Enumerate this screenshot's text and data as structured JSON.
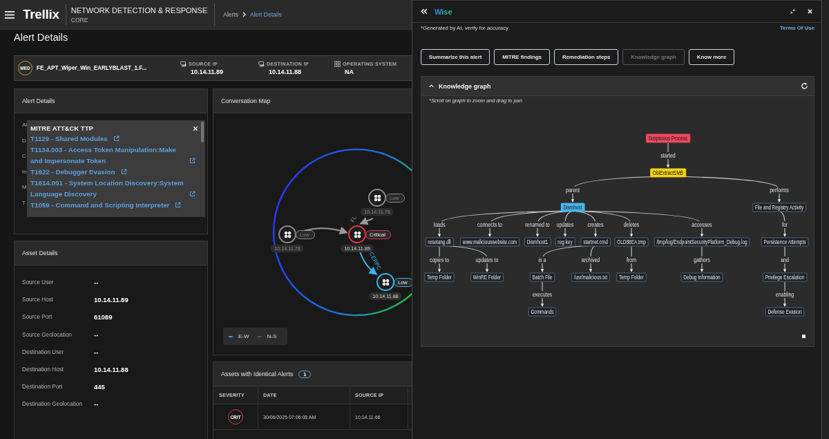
{
  "header": {
    "brand": "Trellix",
    "product": "NETWORK DETECTION & RESPONSE",
    "edition": "CORE",
    "breadcrumb": [
      {
        "label": "Alerts",
        "selected": false
      },
      {
        "label": "Alert Details",
        "selected": true
      }
    ]
  },
  "page_title": "Alert Details",
  "summary": {
    "severity": "MED",
    "name": "FE_APT_Wiper_Win_EARLYBLAST_1.F...",
    "fields": [
      {
        "label": "SOURCE IP",
        "value": "10.14.11.89",
        "kind": "monitor"
      },
      {
        "label": "DESTINATION IP",
        "value": "10.14.11.88",
        "kind": "monitor"
      },
      {
        "label": "OPERATING SYSTEM",
        "value": "NA",
        "kind": "grid"
      }
    ]
  },
  "alert_details": {
    "title": "Alert Details",
    "labels": [
      "Al",
      "D",
      "C",
      "In",
      "M",
      "T"
    ],
    "mitre_popup": {
      "title": "MITRE ATT&CK TTP",
      "links": [
        "T1129 - Shared Modules",
        "T1134.003 - Access Token Manipulation:Make and Impersonate Token",
        "T1622 - Debugger Evasion",
        "T1614.001 - System Location Discovery:System Language Discovery",
        "T1059 - Command and Scripting Interpreter"
      ]
    }
  },
  "asset_details": {
    "title": "Asset Details",
    "rows": [
      {
        "label": "Source User",
        "value": "--"
      },
      {
        "label": "Source Host",
        "value": "10.14.11.89"
      },
      {
        "label": "Source Port",
        "value": "61089"
      },
      {
        "label": "Source Geolocation",
        "value": "--"
      },
      {
        "label": "Destination User",
        "value": "--"
      },
      {
        "label": "Destination Host",
        "value": "10.14.11.88"
      },
      {
        "label": "Destination Port",
        "value": "445"
      },
      {
        "label": "Destination Geolocation",
        "value": "--"
      }
    ]
  },
  "conversation_map": {
    "title": "Conversation Map",
    "nodes": [
      {
        "severity": "Low",
        "ip": "10.14.11.78",
        "color": "#8a8a8a",
        "outgoing": {
          "label": "FL",
          "color": "#9a9a9a"
        }
      },
      {
        "severity": "Low",
        "ip": "10.14.11.78",
        "color": "#8a8a8a",
        "outgoing": {
          "color": "#9a9a9a"
        }
      },
      {
        "severity": "Critical",
        "ip": "10.14.11.89",
        "color": "#e0364a",
        "outgoing": {
          "label": "CERPC",
          "color": "#3ab4e8"
        }
      },
      {
        "severity": "Low",
        "ip": "10.14.11.88",
        "color": "#3ab4e8"
      }
    ],
    "legend": [
      {
        "label": "E-W",
        "color": "#2f9be6"
      },
      {
        "label": "N-S",
        "color": "#555555"
      }
    ]
  },
  "identical_alerts": {
    "title": "Assets with Identical Alerts",
    "count": "1",
    "columns": [
      "SEVERITY",
      "DATE",
      "SOURCE IP"
    ],
    "rows": [
      {
        "severity": "CRIT",
        "date": "30/06/2025 07:06:08 AM",
        "source_ip": "10.14.11.66"
      }
    ]
  },
  "wise_panel": {
    "title": "Wise",
    "disclaimer": "*Generated by AI, verify for accuracy",
    "terms_link": "Terms Of Use",
    "actions": [
      {
        "label": "Summarize this alert",
        "disabled": false
      },
      {
        "label": "MITRE findings",
        "disabled": false
      },
      {
        "label": "Remediation steps",
        "disabled": false
      },
      {
        "label": "Knowledge graph",
        "disabled": true
      },
      {
        "label": "Know more",
        "disabled": false
      }
    ],
    "knowledge_graph": {
      "title": "Knowledge graph",
      "expanded": true,
      "hint": "*Scroll on graph to zoom and drag to pan",
      "root": {
        "label": "Suspicious Process",
        "color": "#ef4a5f",
        "children": [
          {
            "edge": "started",
            "label": "ObiExtractSMB",
            "color": "#f5d31a",
            "children": [
              {
                "edge": "parent",
                "label": "Dismhost",
                "color": "#4ab8ee",
                "children": [
                  {
                    "edge": "loads",
                    "label": "resetang.dll",
                    "color": "#1c1f24",
                    "children": [
                      {
                        "edge": "copies to",
                        "label": "Temp Folder",
                        "color": "#1c1f24"
                      },
                      {
                        "edge": "updates to",
                        "label": "WinRE Folder",
                        "color": "#1c1f24"
                      }
                    ]
                  },
                  {
                    "edge": "connects to",
                    "label": "www.maliciouswebsite.com",
                    "color": "#1c1f24"
                  },
                  {
                    "edge": "renamed to",
                    "label": "Dismhost1",
                    "color": "#1c1f24"
                  },
                  {
                    "edge": "updates",
                    "label": "reg key",
                    "color": "#1c1f24"
                  },
                  {
                    "edge": "creates",
                    "label": "startnet.cmd",
                    "color": "#1c1f24",
                    "children": [
                      {
                        "edge": "is a",
                        "label": "Batch File",
                        "color": "#1c1f24",
                        "children": [
                          {
                            "edge": "executes",
                            "label": "Commands",
                            "color": "#1c1f24"
                          }
                        ]
                      },
                      {
                        "edge": "archived",
                        "label": "/usr/malicious.txt",
                        "color": "#1c1f24"
                      }
                    ]
                  },
                  {
                    "edge": "deletes",
                    "label": "OLD88EA.tmp",
                    "color": "#1c1f24",
                    "children": [
                      {
                        "edge": "from",
                        "label": "Temp Folder",
                        "color": "#1c1f24"
                      }
                    ]
                  },
                  {
                    "edge": "accesses",
                    "label": "/tmp/log/EndpointSecurityPlatform_Debug.log",
                    "color": "#1c1f24",
                    "children": [
                      {
                        "edge": "gathers",
                        "label": "Debug Information",
                        "color": "#1c1f24"
                      }
                    ]
                  }
                ]
              },
              {
                "edge": "performs",
                "label": "File and Registry Activity",
                "color": "#1c1f24",
                "children": [
                  {
                    "edge": "for",
                    "label": "Persistence Attempts",
                    "color": "#1c1f24",
                    "children": [
                      {
                        "edge": "and",
                        "label": "Privilege Escalation",
                        "color": "#1c1f24",
                        "children": [
                          {
                            "edge": "enabling",
                            "label": "Defense Evasion",
                            "color": "#1c1f24"
                          }
                        ]
                      }
                    ]
                  }
                ]
              }
            ]
          }
        ]
      }
    }
  }
}
